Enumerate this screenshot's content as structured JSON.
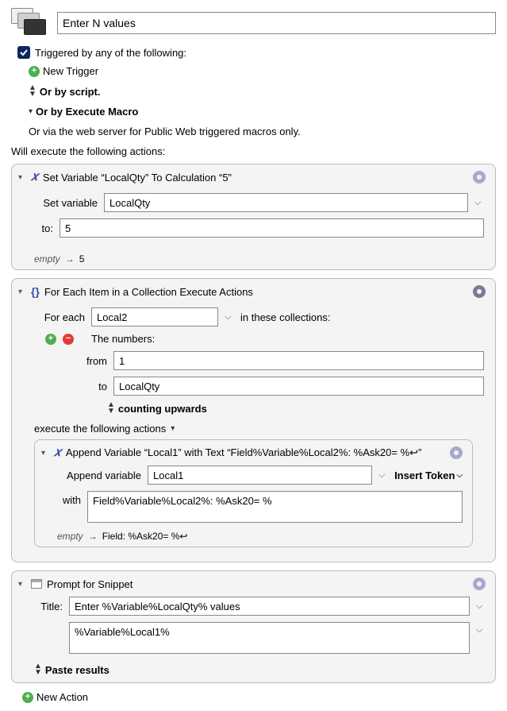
{
  "header": {
    "title_value": "Enter N values"
  },
  "triggers": {
    "checkbox_label": "Triggered by any of the following:",
    "new_trigger": "New Trigger",
    "or_script": "Or by script.",
    "or_execute": "Or by Execute Macro",
    "or_web": "Or via the web server for Public Web triggered macros only."
  },
  "actions_intro": "Will execute the following actions:",
  "action1": {
    "title": "Set Variable “LocalQty” To Calculation “5”",
    "set_variable_label": "Set variable",
    "variable_value": "LocalQty",
    "to_label": "to:",
    "to_value": "5",
    "status_empty": "empty",
    "status_result": "5"
  },
  "action2": {
    "title": "For Each Item in a Collection Execute Actions",
    "for_each_label": "For each",
    "variable_value": "Local2",
    "collections_label": "in these collections:",
    "numbers_label": "The numbers:",
    "from_label": "from",
    "from_value": "1",
    "to_label": "to",
    "to_value": "LocalQty",
    "counting_label": "counting upwards",
    "execute_label": "execute the following actions"
  },
  "action2_inner": {
    "title": "Append Variable “Local1” with Text “Field%Variable%Local2%: %Ask20= %↩”",
    "append_label": "Append variable",
    "variable_value": "Local1",
    "insert_token": "Insert Token",
    "with_label": "with",
    "with_value": "Field%Variable%Local2%: %Ask20= %",
    "status_empty": "empty",
    "status_result": "Field: %Ask20= %↩"
  },
  "action3": {
    "title": "Prompt for Snippet",
    "title_label": "Title:",
    "title_value": "Enter %Variable%LocalQty% values",
    "body_value": "%Variable%Local1%",
    "paste_label": "Paste results"
  },
  "footer": {
    "new_action": "New Action"
  }
}
